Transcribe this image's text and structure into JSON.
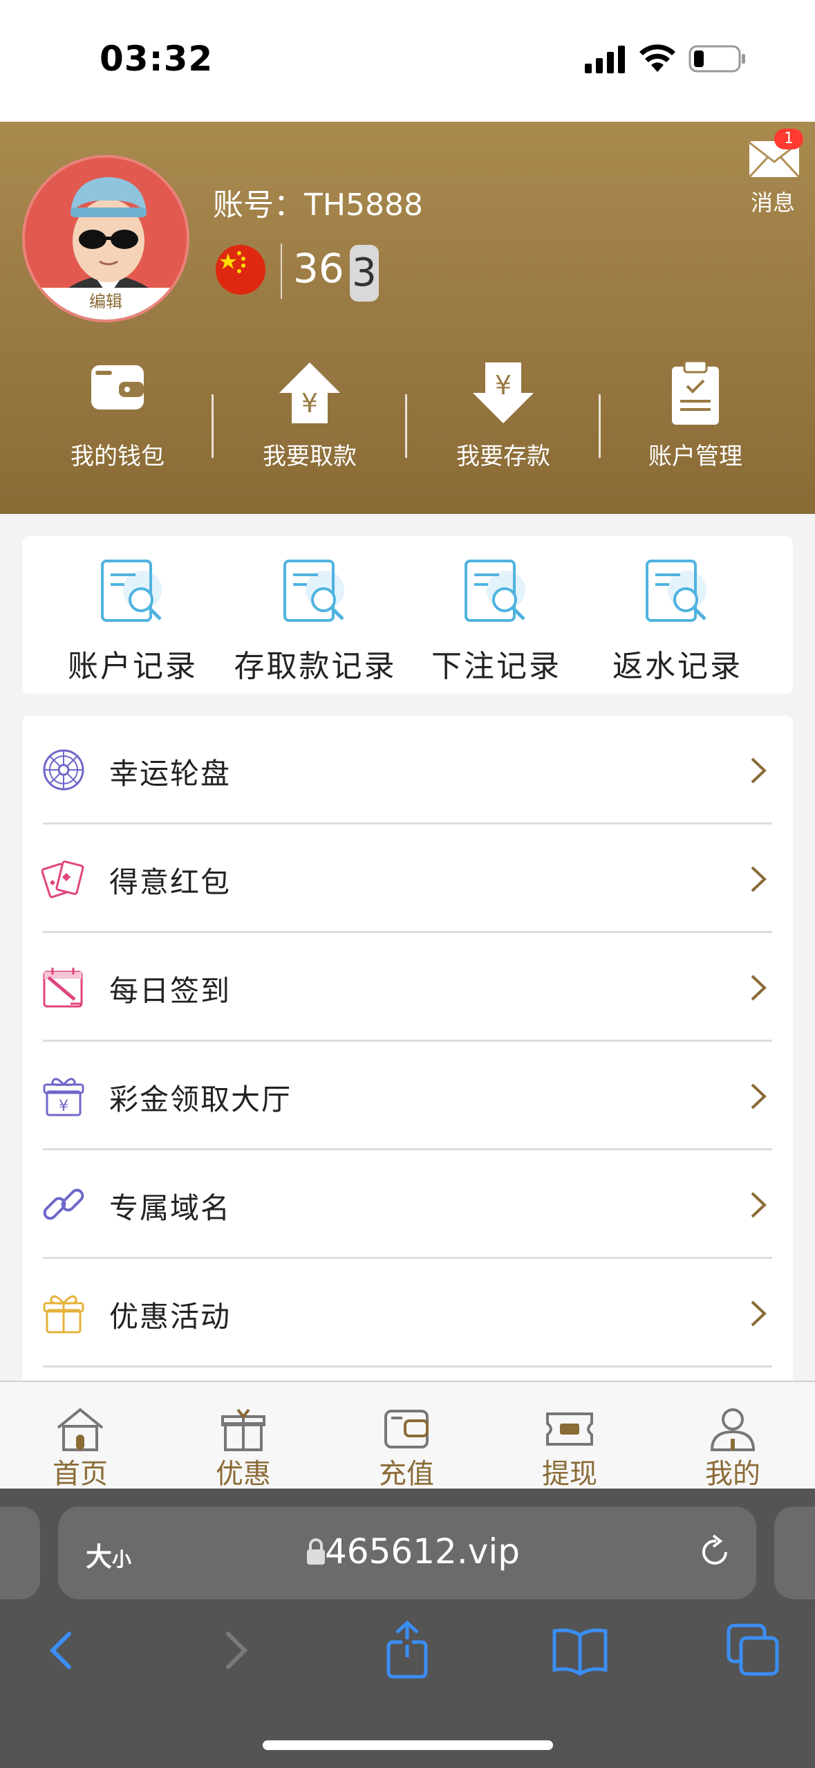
{
  "status_bar": {
    "time": "03:32"
  },
  "profile": {
    "avatar_edit_label": "编辑",
    "account_label": "账号：TH5888",
    "number_primary": "36",
    "number_secondary": "3",
    "message_label": "消息",
    "message_badge": "1"
  },
  "header_actions": [
    {
      "label": "我的钱包",
      "icon": "wallet-icon"
    },
    {
      "label": "我要取款",
      "icon": "withdraw-icon"
    },
    {
      "label": "我要存款",
      "icon": "deposit-icon"
    },
    {
      "label": "账户管理",
      "icon": "clipboard-icon"
    }
  ],
  "records": [
    {
      "label": "账户记录",
      "icon": "document-search-icon"
    },
    {
      "label": "存取款记录",
      "icon": "document-search-icon"
    },
    {
      "label": "下注记录",
      "icon": "document-search-icon"
    },
    {
      "label": "返水记录",
      "icon": "document-search-icon"
    }
  ],
  "menu": [
    {
      "label": "幸运轮盘",
      "icon": "wheel-icon"
    },
    {
      "label": "得意红包",
      "icon": "red-envelope-icon"
    },
    {
      "label": "每日签到",
      "icon": "calendar-checkin-icon"
    },
    {
      "label": "彩金领取大厅",
      "icon": "gift-yuan-icon"
    },
    {
      "label": "专属域名",
      "icon": "link-icon"
    },
    {
      "label": "优惠活动",
      "icon": "gift-icon"
    }
  ],
  "bottom_nav": [
    {
      "label": "首页",
      "icon": "home-icon"
    },
    {
      "label": "优惠",
      "icon": "gift-icon"
    },
    {
      "label": "充值",
      "icon": "wallet-icon"
    },
    {
      "label": "提现",
      "icon": "cash-icon"
    },
    {
      "label": "我的",
      "icon": "user-icon"
    }
  ],
  "browser": {
    "text_size_label": "大",
    "text_size_small": "小",
    "url": "465612.vip"
  },
  "colors": {
    "header_gold": "#9a7a44",
    "accent_brown": "#8a6b36",
    "record_icon_blue": "#4fb3e0",
    "badge_red": "#ff3b30",
    "safari_blue": "#3b8ef5"
  }
}
